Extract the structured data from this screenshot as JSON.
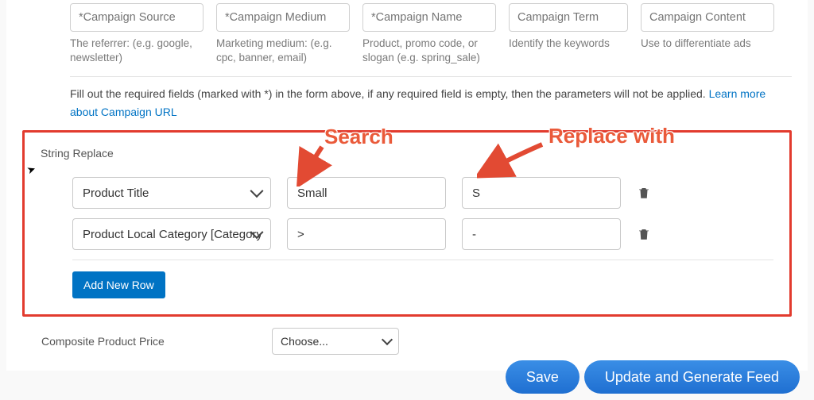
{
  "campaign_fields": [
    {
      "placeholder": "*Campaign Source",
      "hint": "The referrer: (e.g. google, newsletter)"
    },
    {
      "placeholder": "*Campaign Medium",
      "hint": "Marketing medium: (e.g. cpc, banner, email)"
    },
    {
      "placeholder": "*Campaign Name",
      "hint": "Product, promo code, or slogan (e.g. spring_sale)"
    },
    {
      "placeholder": "Campaign Term",
      "hint": "Identify the keywords"
    },
    {
      "placeholder": "Campaign Content",
      "hint": "Use to differentiate ads"
    }
  ],
  "info": {
    "text": "Fill out the required fields (marked with *) in the form above, if any required field is empty, then the parameters will not be applied. ",
    "link": "Learn more about Campaign URL"
  },
  "string_replace": {
    "label": "String Replace",
    "rows": [
      {
        "field": "Product Title",
        "search": "Small",
        "replace": "S"
      },
      {
        "field": "Product Local Category [Category",
        "search": ">",
        "replace": "-"
      }
    ],
    "add_button": "Add New Row"
  },
  "composite": {
    "label": "Composite Product Price",
    "selected": "Choose..."
  },
  "callouts": {
    "search": "Search",
    "replace": "Replace with"
  },
  "footer": {
    "save": "Save",
    "generate": "Update and Generate Feed"
  },
  "colors": {
    "highlight": "#e23b2e",
    "primary": "#0073c4",
    "pill": "#2a7dd9"
  }
}
